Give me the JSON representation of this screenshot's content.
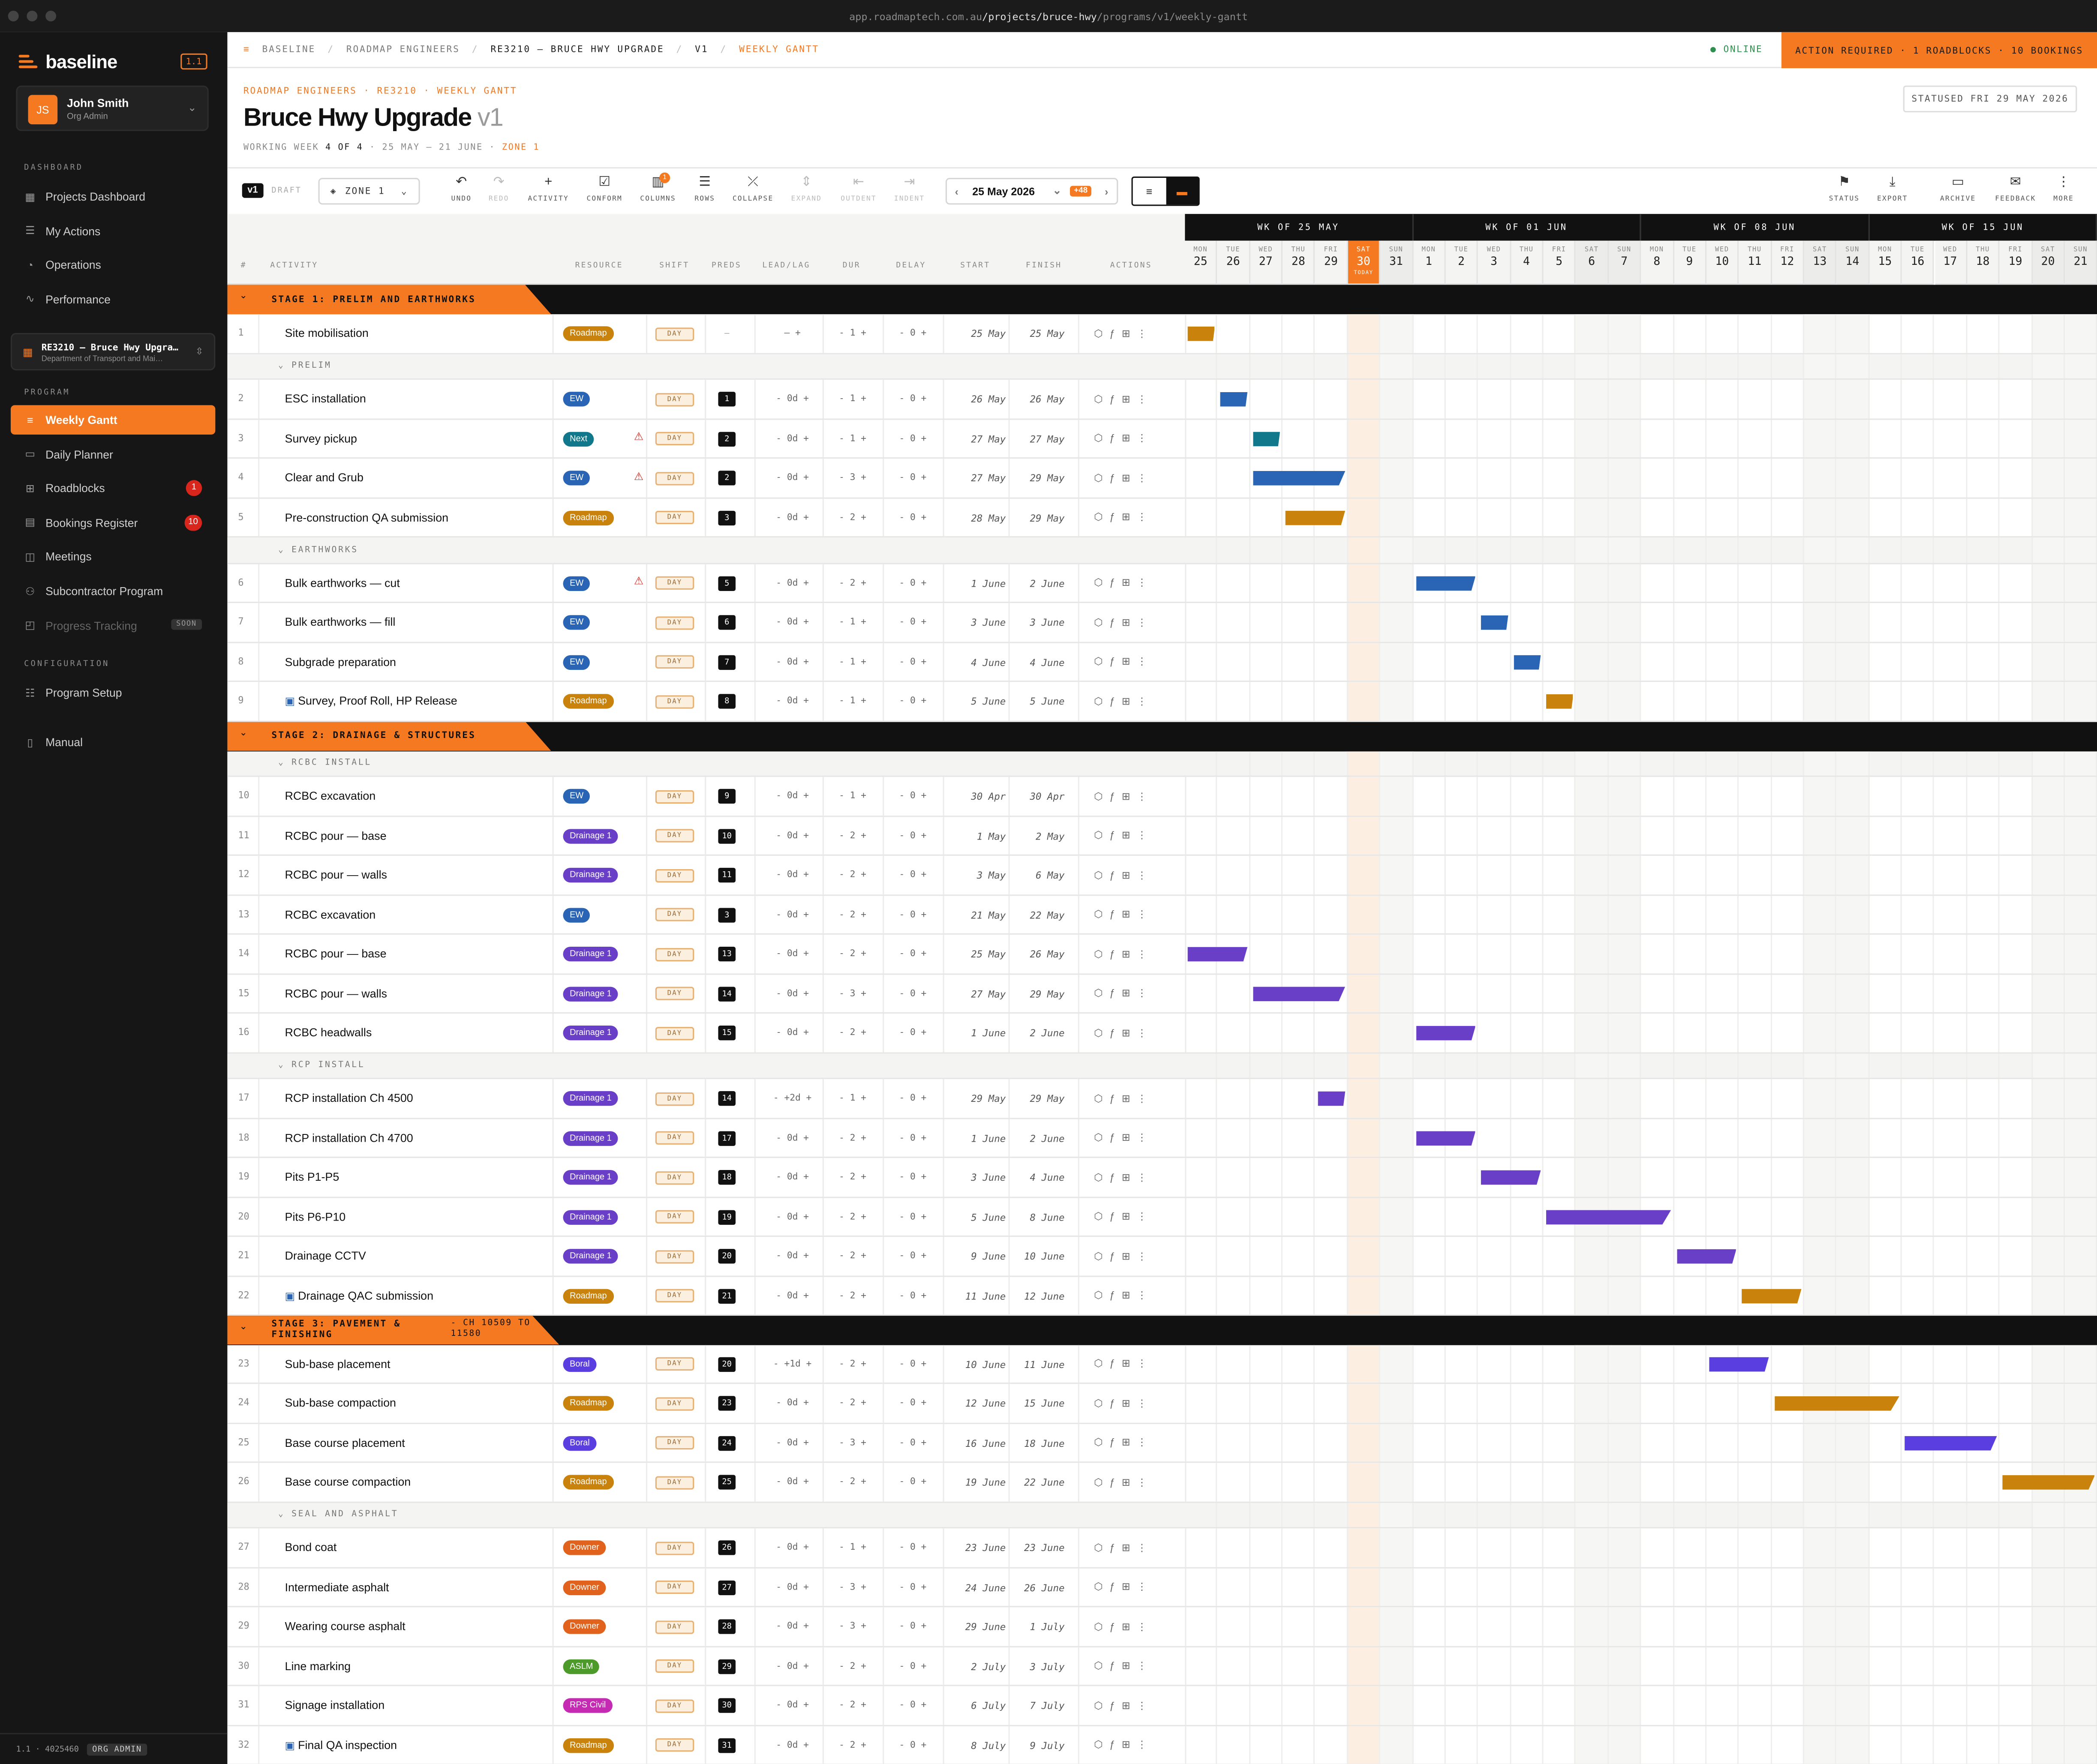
{
  "window": {
    "url_pre": "app.roadmaptech.com.au",
    "url_bold": "/projects/bruce-hwy",
    "url_post": "/programs/v1/weekly-gantt"
  },
  "sidebar": {
    "brand": "baseline",
    "version": "1.1",
    "user": {
      "initials": "JS",
      "name": "John Smith",
      "role": "Org Admin"
    },
    "section_dashboard": "DASHBOARD",
    "dashboard_items": [
      {
        "label": "Projects Dashboard",
        "icon": "grid-icon"
      },
      {
        "label": "My Actions",
        "icon": "checklist-icon"
      },
      {
        "label": "Operations",
        "icon": "gauge-icon"
      },
      {
        "label": "Performance",
        "icon": "pulse-icon"
      }
    ],
    "project": {
      "title": "RE3210 — Bruce Hwy Upgra…",
      "subtitle": "Department of Transport and Mai…"
    },
    "section_program": "PROGRAM",
    "program_items": [
      {
        "label": "Weekly Gantt",
        "icon": "gantt-icon",
        "active": true
      },
      {
        "label": "Daily Planner",
        "icon": "calendar-icon"
      },
      {
        "label": "Roadblocks",
        "icon": "barrier-icon",
        "badge": "1"
      },
      {
        "label": "Bookings Register",
        "icon": "book-icon",
        "badge": "10"
      },
      {
        "label": "Meetings",
        "icon": "meeting-icon"
      },
      {
        "label": "Subcontractor Program",
        "icon": "people-icon"
      },
      {
        "label": "Progress Tracking",
        "icon": "chart-icon",
        "soon": "SOON"
      }
    ],
    "section_config": "CONFIGURATION",
    "config_items": [
      {
        "label": "Program Setup",
        "icon": "sliders-icon"
      }
    ],
    "manual": "Manual",
    "footer": {
      "version": "1.1 · 4025460",
      "role": "ORG ADMIN"
    }
  },
  "topbar": {
    "crumbs": [
      "BASELINE",
      "ROADMAP ENGINEERS",
      "RE3210 — BRUCE HWY UPGRADE",
      "V1",
      "WEEKLY GANTT"
    ],
    "status": "ONLINE",
    "alert": "ACTION REQUIRED · 1 ROADBLOCKS · 10 BOOKINGS"
  },
  "header": {
    "subcrumb": "ROADMAP ENGINEERS · RE3210 · WEEKLY GANTT",
    "title": "Bruce Hwy Upgrade",
    "version": "v1",
    "week_prefix": "WORKING WEEK",
    "week_value": "4 OF 4",
    "week_range": "· 25 MAY — 21 JUNE ·",
    "zone": "ZONE 1",
    "statused": "STATUSED FRI 29 MAY 2026"
  },
  "toolbar": {
    "version": "v1",
    "draft": "DRAFT",
    "zone": "ZONE 1",
    "left_buttons": [
      {
        "label": "UNDO",
        "icon": "↶"
      },
      {
        "label": "REDO",
        "icon": "↷",
        "disabled": true
      },
      {
        "label": "ACTIVITY",
        "icon": "+"
      },
      {
        "label": "CONFORM",
        "icon": "☑"
      },
      {
        "label": "COLUMNS",
        "icon": "▥",
        "badge": "1"
      },
      {
        "label": "ROWS",
        "icon": "☰"
      },
      {
        "label": "COLLAPSE",
        "icon": "⤫"
      },
      {
        "label": "EXPAND",
        "icon": "⇕",
        "disabled": true
      },
      {
        "label": "OUTDENT",
        "icon": "⇤",
        "disabled": true
      },
      {
        "label": "INDENT",
        "icon": "⇥",
        "disabled": true
      }
    ],
    "date": "25 May 2026",
    "date_badge": "+48",
    "right_buttons": [
      {
        "label": "STATUS",
        "icon": "⚑"
      },
      {
        "label": "EXPORT",
        "icon": "⤓"
      },
      {
        "label": "ARCHIVE",
        "icon": "▭"
      },
      {
        "label": "FEEDBACK",
        "icon": "✉"
      },
      {
        "label": "MORE",
        "icon": "⋮"
      }
    ]
  },
  "columns": {
    "num": "#",
    "activity": "ACTIVITY",
    "resource": "RESOURCE",
    "shift": "SHIFT",
    "preds": "PREDS",
    "leadlag": "LEAD/LAG",
    "dur": "DUR",
    "delay": "DELAY",
    "start": "START",
    "finish": "FINISH",
    "actions": "ACTIONS"
  },
  "weeks": [
    "WK OF 25 MAY",
    "WK OF 01 JUN",
    "WK OF 08 JUN",
    "WK OF 15 JUN"
  ],
  "days": [
    [
      "MON",
      "25"
    ],
    [
      "TUE",
      "26"
    ],
    [
      "WED",
      "27"
    ],
    [
      "THU",
      "28"
    ],
    [
      "FRI",
      "29"
    ],
    [
      "SAT",
      "30"
    ],
    [
      "SUN",
      "31"
    ],
    [
      "MON",
      "1"
    ],
    [
      "TUE",
      "2"
    ],
    [
      "WED",
      "3"
    ],
    [
      "THU",
      "4"
    ],
    [
      "FRI",
      "5"
    ],
    [
      "SAT",
      "6"
    ],
    [
      "SUN",
      "7"
    ],
    [
      "MON",
      "8"
    ],
    [
      "TUE",
      "9"
    ],
    [
      "WED",
      "10"
    ],
    [
      "THU",
      "11"
    ],
    [
      "FRI",
      "12"
    ],
    [
      "SAT",
      "13"
    ],
    [
      "SUN",
      "14"
    ],
    [
      "MON",
      "15"
    ],
    [
      "TUE",
      "16"
    ],
    [
      "WED",
      "17"
    ],
    [
      "THU",
      "18"
    ],
    [
      "FRI",
      "19"
    ],
    [
      "SAT",
      "20"
    ],
    [
      "SUN",
      "21"
    ]
  ],
  "today_label": "TODAY",
  "resource_colors": {
    "Roadmap": "#c9830c",
    "EW": "#2a64b4",
    "Next": "#11788c",
    "Drainage 1": "#6a3fc7",
    "Boral": "#5b3ee0",
    "Downer": "#e0621c",
    "ASLM": "#4c9a2a",
    "RPS Civil": "#c42ab2"
  },
  "rows": [
    {
      "type": "stage",
      "label": "STAGE 1: PRELIM AND EARTHWORKS"
    },
    {
      "type": "task",
      "num": "1",
      "name": "Site mobilisation",
      "res": "Roadmap",
      "shift": "DAY",
      "pred": "—",
      "lag": "— +",
      "dur": "- 1 +",
      "delay": "- 0 +",
      "start": "25 May",
      "finish": "25 May",
      "bar": [
        0,
        1
      ]
    },
    {
      "type": "group",
      "label": "PRELIM"
    },
    {
      "type": "task",
      "num": "2",
      "name": "ESC installation",
      "res": "EW",
      "shift": "DAY",
      "pred": "1",
      "lag": "- 0d +",
      "dur": "- 1 +",
      "delay": "- 0 +",
      "start": "26 May",
      "finish": "26 May",
      "bar": [
        1,
        1
      ]
    },
    {
      "type": "task",
      "num": "3",
      "name": "Survey pickup",
      "res": "Next",
      "warn": true,
      "shift": "DAY",
      "pred": "2",
      "lag": "- 0d +",
      "dur": "- 1 +",
      "delay": "- 0 +",
      "start": "27 May",
      "finish": "27 May",
      "bar": [
        2,
        1
      ]
    },
    {
      "type": "task",
      "num": "4",
      "name": "Clear and Grub",
      "res": "EW",
      "warn": true,
      "shift": "DAY",
      "pred": "2",
      "lag": "- 0d +",
      "dur": "- 3 +",
      "delay": "- 0 +",
      "start": "27 May",
      "finish": "29 May",
      "bar": [
        2,
        3
      ]
    },
    {
      "type": "task",
      "num": "5",
      "name": "Pre-construction QA submission",
      "res": "Roadmap",
      "shift": "DAY",
      "pred": "3",
      "lag": "- 0d +",
      "dur": "- 2 +",
      "delay": "- 0 +",
      "start": "28 May",
      "finish": "29 May",
      "bar": [
        3,
        2
      ]
    },
    {
      "type": "group",
      "label": "EARTHWORKS"
    },
    {
      "type": "task",
      "num": "6",
      "name": "Bulk earthworks — cut",
      "res": "EW",
      "warn": true,
      "shift": "DAY",
      "pred": "5",
      "lag": "- 0d +",
      "dur": "- 2 +",
      "delay": "- 0 +",
      "start": "1 June",
      "finish": "2 June",
      "bar": [
        7,
        2
      ]
    },
    {
      "type": "task",
      "num": "7",
      "name": "Bulk earthworks — fill",
      "res": "EW",
      "shift": "DAY",
      "pred": "6",
      "lag": "- 0d +",
      "dur": "- 1 +",
      "delay": "- 0 +",
      "start": "3 June",
      "finish": "3 June",
      "bar": [
        9,
        1
      ]
    },
    {
      "type": "task",
      "num": "8",
      "name": "Subgrade preparation",
      "res": "EW",
      "shift": "DAY",
      "pred": "7",
      "lag": "- 0d +",
      "dur": "- 1 +",
      "delay": "- 0 +",
      "start": "4 June",
      "finish": "4 June",
      "bar": [
        10,
        1
      ]
    },
    {
      "type": "task",
      "num": "9",
      "name": "Survey, Proof Roll, HP Release",
      "res": "Roadmap",
      "clip": true,
      "shift": "DAY",
      "pred": "8",
      "lag": "- 0d +",
      "dur": "- 1 +",
      "delay": "- 0 +",
      "start": "5 June",
      "finish": "5 June",
      "bar": [
        11,
        1
      ]
    },
    {
      "type": "stage",
      "label": "STAGE 2: DRAINAGE & STRUCTURES"
    },
    {
      "type": "group",
      "label": "RCBC INSTALL"
    },
    {
      "type": "task",
      "num": "10",
      "name": "RCBC excavation",
      "res": "EW",
      "shift": "DAY",
      "pred": "9",
      "lag": "- 0d +",
      "dur": "- 1 +",
      "delay": "- 0 +",
      "start": "30 Apr",
      "finish": "30 Apr"
    },
    {
      "type": "task",
      "num": "11",
      "name": "RCBC pour — base",
      "res": "Drainage 1",
      "shift": "DAY",
      "pred": "10",
      "lag": "- 0d +",
      "dur": "- 2 +",
      "delay": "- 0 +",
      "start": "1 May",
      "finish": "2 May"
    },
    {
      "type": "task",
      "num": "12",
      "name": "RCBC pour — walls",
      "res": "Drainage 1",
      "shift": "DAY",
      "pred": "11",
      "lag": "- 0d +",
      "dur": "- 2 +",
      "delay": "- 0 +",
      "start": "3 May",
      "finish": "6 May"
    },
    {
      "type": "task",
      "num": "13",
      "name": "RCBC excavation",
      "res": "EW",
      "shift": "DAY",
      "pred": "3",
      "lag": "- 0d +",
      "dur": "- 2 +",
      "delay": "- 0 +",
      "start": "21 May",
      "finish": "22 May"
    },
    {
      "type": "task",
      "num": "14",
      "name": "RCBC pour — base",
      "res": "Drainage 1",
      "shift": "DAY",
      "pred": "13",
      "lag": "- 0d +",
      "dur": "- 2 +",
      "delay": "- 0 +",
      "start": "25 May",
      "finish": "26 May",
      "bar": [
        0,
        2
      ]
    },
    {
      "type": "task",
      "num": "15",
      "name": "RCBC pour — walls",
      "res": "Drainage 1",
      "shift": "DAY",
      "pred": "14",
      "lag": "- 0d +",
      "dur": "- 3 +",
      "delay": "- 0 +",
      "start": "27 May",
      "finish": "29 May",
      "bar": [
        2,
        3
      ]
    },
    {
      "type": "task",
      "num": "16",
      "name": "RCBC headwalls",
      "res": "Drainage 1",
      "shift": "DAY",
      "pred": "15",
      "lag": "- 0d +",
      "dur": "- 2 +",
      "delay": "- 0 +",
      "start": "1 June",
      "finish": "2 June",
      "bar": [
        7,
        2
      ]
    },
    {
      "type": "group",
      "label": "RCP INSTALL"
    },
    {
      "type": "task",
      "num": "17",
      "name": "RCP installation Ch 4500",
      "res": "Drainage 1",
      "shift": "DAY",
      "pred": "14",
      "lag": "- +2d +",
      "dur": "- 1 +",
      "delay": "- 0 +",
      "start": "29 May",
      "finish": "29 May",
      "bar": [
        4,
        1
      ]
    },
    {
      "type": "task",
      "num": "18",
      "name": "RCP installation Ch 4700",
      "res": "Drainage 1",
      "shift": "DAY",
      "pred": "17",
      "lag": "- 0d +",
      "dur": "- 2 +",
      "delay": "- 0 +",
      "start": "1 June",
      "finish": "2 June",
      "bar": [
        7,
        2
      ]
    },
    {
      "type": "task",
      "num": "19",
      "name": "Pits P1-P5",
      "res": "Drainage 1",
      "shift": "DAY",
      "pred": "18",
      "lag": "- 0d +",
      "dur": "- 2 +",
      "delay": "- 0 +",
      "start": "3 June",
      "finish": "4 June",
      "bar": [
        9,
        2
      ]
    },
    {
      "type": "task",
      "num": "20",
      "name": "Pits P6-P10",
      "res": "Drainage 1",
      "shift": "DAY",
      "pred": "19",
      "lag": "- 0d +",
      "dur": "- 2 +",
      "delay": "- 0 +",
      "start": "5 June",
      "finish": "8 June",
      "bar": [
        11,
        4
      ]
    },
    {
      "type": "task",
      "num": "21",
      "name": "Drainage CCTV",
      "res": "Drainage 1",
      "shift": "DAY",
      "pred": "20",
      "lag": "- 0d +",
      "dur": "- 2 +",
      "delay": "- 0 +",
      "start": "9 June",
      "finish": "10 June",
      "bar": [
        15,
        2
      ]
    },
    {
      "type": "task",
      "num": "22",
      "name": "Drainage QAC submission",
      "res": "Roadmap",
      "clip": true,
      "shift": "DAY",
      "pred": "21",
      "lag": "- 0d +",
      "dur": "- 2 +",
      "delay": "- 0 +",
      "start": "11 June",
      "finish": "12 June",
      "bar": [
        17,
        2
      ]
    },
    {
      "type": "stage",
      "label": "STAGE 3: PAVEMENT & FINISHING",
      "sub": "- CH 10509 TO 11580"
    },
    {
      "type": "task",
      "num": "23",
      "name": "Sub-base placement",
      "res": "Boral",
      "shift": "DAY",
      "pred": "20",
      "lag": "- +1d +",
      "dur": "- 2 +",
      "delay": "- 0 +",
      "start": "10 June",
      "finish": "11 June",
      "bar": [
        16,
        2
      ]
    },
    {
      "type": "task",
      "num": "24",
      "name": "Sub-base compaction",
      "res": "Roadmap",
      "shift": "DAY",
      "pred": "23",
      "lag": "- 0d +",
      "dur": "- 2 +",
      "delay": "- 0 +",
      "start": "12 June",
      "finish": "15 June",
      "bar": [
        18,
        4
      ]
    },
    {
      "type": "task",
      "num": "25",
      "name": "Base course placement",
      "res": "Boral",
      "shift": "DAY",
      "pred": "24",
      "lag": "- 0d +",
      "dur": "- 3 +",
      "delay": "- 0 +",
      "start": "16 June",
      "finish": "18 June",
      "bar": [
        22,
        3
      ]
    },
    {
      "type": "task",
      "num": "26",
      "name": "Base course compaction",
      "res": "Roadmap",
      "shift": "DAY",
      "pred": "25",
      "lag": "- 0d +",
      "dur": "- 2 +",
      "delay": "- 0 +",
      "start": "19 June",
      "finish": "22 June",
      "bar": [
        25,
        3
      ]
    },
    {
      "type": "group",
      "label": "SEAL AND ASPHALT"
    },
    {
      "type": "task",
      "num": "27",
      "name": "Bond coat",
      "res": "Downer",
      "shift": "DAY",
      "pred": "26",
      "lag": "- 0d +",
      "dur": "- 1 +",
      "delay": "- 0 +",
      "start": "23 June",
      "finish": "23 June"
    },
    {
      "type": "task",
      "num": "28",
      "name": "Intermediate asphalt",
      "res": "Downer",
      "shift": "DAY",
      "pred": "27",
      "lag": "- 0d +",
      "dur": "- 3 +",
      "delay": "- 0 +",
      "start": "24 June",
      "finish": "26 June"
    },
    {
      "type": "task",
      "num": "29",
      "name": "Wearing course asphalt",
      "res": "Downer",
      "shift": "DAY",
      "pred": "28",
      "lag": "- 0d +",
      "dur": "- 3 +",
      "delay": "- 0 +",
      "start": "29 June",
      "finish": "1 July"
    },
    {
      "type": "task",
      "num": "30",
      "name": "Line marking",
      "res": "ASLM",
      "shift": "DAY",
      "pred": "29",
      "lag": "- 0d +",
      "dur": "- 2 +",
      "delay": "- 0 +",
      "start": "2 July",
      "finish": "3 July"
    },
    {
      "type": "task",
      "num": "31",
      "name": "Signage installation",
      "res": "RPS Civil",
      "shift": "DAY",
      "pred": "30",
      "lag": "- 0d +",
      "dur": "- 2 +",
      "delay": "- 0 +",
      "start": "6 July",
      "finish": "7 July"
    },
    {
      "type": "task",
      "num": "32",
      "name": "Final QA inspection",
      "res": "Roadmap",
      "clip": true,
      "shift": "DAY",
      "pred": "31",
      "lag": "- 0d +",
      "dur": "- 2 +",
      "delay": "- 0 +",
      "start": "8 July",
      "finish": "9 July"
    }
  ]
}
